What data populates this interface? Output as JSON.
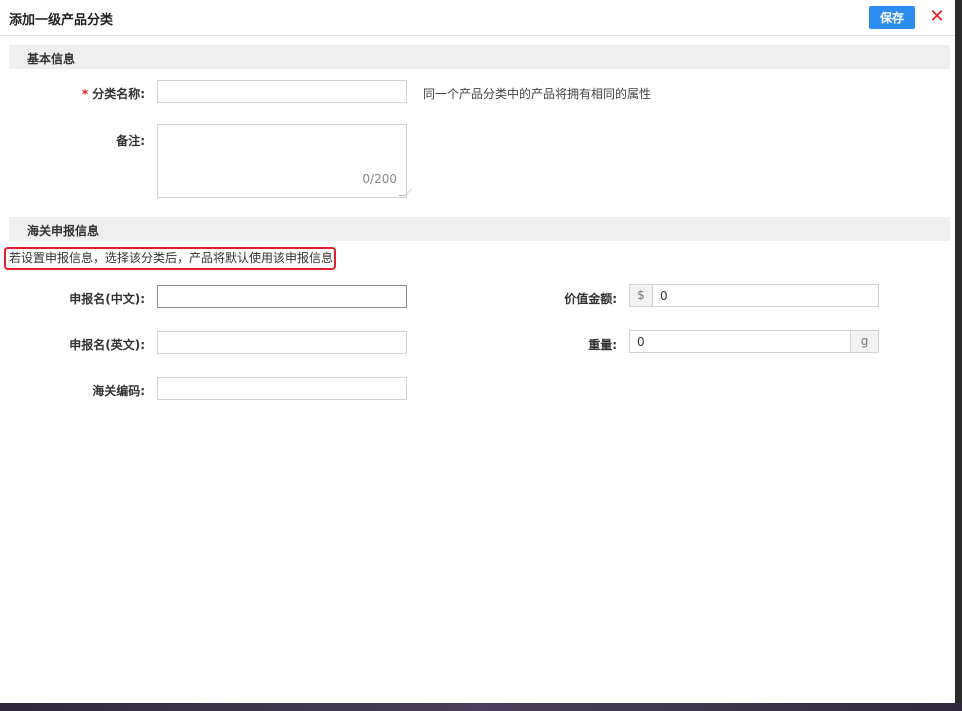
{
  "dialog": {
    "title": "添加一级产品分类",
    "save_label": "保存",
    "close_glyph": "✕",
    "accent_color": "#2d8cf0",
    "close_color": "#e02020"
  },
  "basic_info": {
    "header": "基本信息",
    "category_name": {
      "required_mark": "*",
      "label": "分类名称:",
      "value": "",
      "hint": "同一个产品分类中的产品将拥有相同的属性"
    },
    "remark": {
      "label": "备注:",
      "value": "",
      "counter": "0/200"
    }
  },
  "customs_info": {
    "header": "海关申报信息",
    "notice": "若设置申报信息，选择该分类后，产品将默认使用该申报信息",
    "name_cn": {
      "label": "申报名(中文):",
      "value": ""
    },
    "name_en": {
      "label": "申报名(英文):",
      "value": ""
    },
    "hs_code": {
      "label": "海关编码:",
      "value": ""
    },
    "declared_value": {
      "label": "价值金额:",
      "prefix": "$",
      "value": "0"
    },
    "weight": {
      "label": "重量:",
      "value": "0",
      "suffix": "g"
    }
  }
}
